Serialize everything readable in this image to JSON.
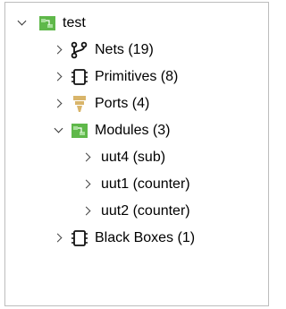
{
  "tree": {
    "root": {
      "label": "test",
      "icon": "module-icon",
      "expanded": true
    },
    "items": [
      {
        "label": "Nets (19)",
        "icon": "nets-branch-icon",
        "expanded": false
      },
      {
        "label": "Primitives (8)",
        "icon": "primitive-chip-icon",
        "expanded": false
      },
      {
        "label": "Ports (4)",
        "icon": "port-funnel-icon",
        "expanded": false
      },
      {
        "label": "Modules (3)",
        "icon": "module-icon",
        "expanded": true,
        "children": [
          {
            "label": "uut4 (sub)"
          },
          {
            "label": "uut1 (counter)"
          },
          {
            "label": "uut2 (counter)"
          }
        ]
      },
      {
        "label": "Black Boxes (1)",
        "icon": "primitive-chip-icon",
        "expanded": false
      }
    ]
  },
  "colors": {
    "module_green": "#5fb84a",
    "port_amber": "#d9b56a",
    "border": "#bdbdbd"
  }
}
